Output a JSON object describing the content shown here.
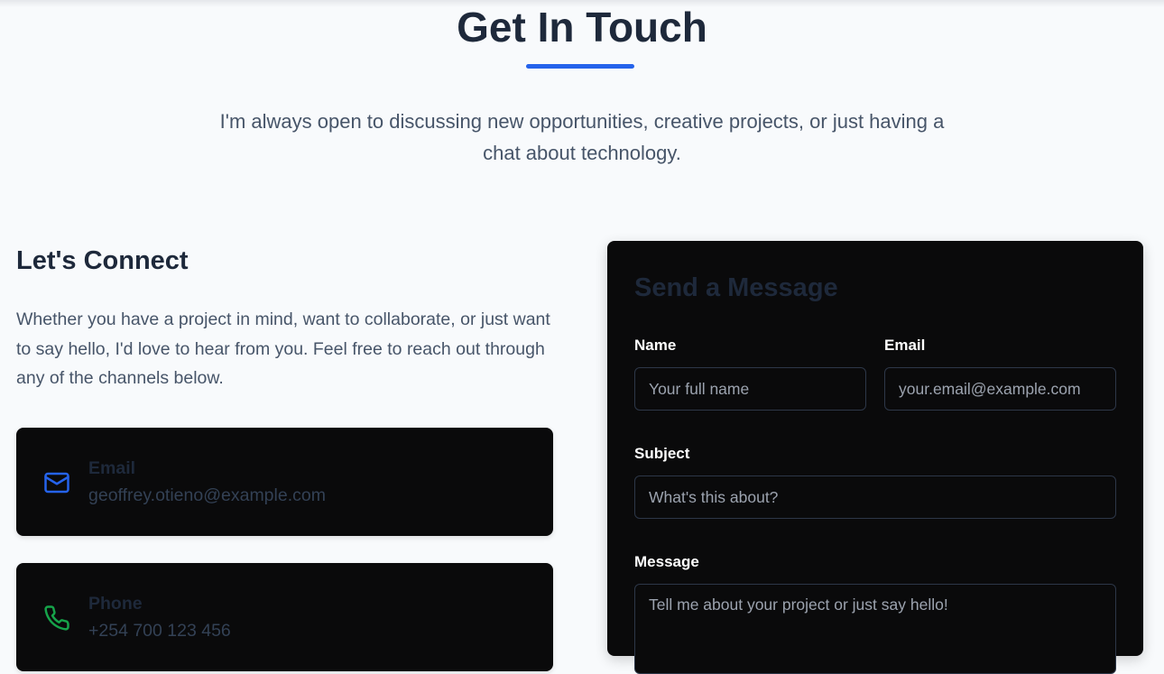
{
  "header": {
    "title": "Get In Touch",
    "intro": "I'm always open to discussing new opportunities, creative projects, or just having a chat about technology."
  },
  "connect": {
    "title": "Let's Connect",
    "text": "Whether you have a project in mind, want to collaborate, or just want to say hello, I'd love to hear from you. Feel free to reach out through any of the channels below.",
    "cards": [
      {
        "label": "Email",
        "value": "geoffrey.otieno@example.com",
        "icon": "mail-icon",
        "color": "#2563eb"
      },
      {
        "label": "Phone",
        "value": "+254 700 123 456",
        "icon": "phone-icon",
        "color": "#16a34a"
      }
    ]
  },
  "form": {
    "title": "Send a Message",
    "name_label": "Name",
    "name_placeholder": "Your full name",
    "email_label": "Email",
    "email_placeholder": "your.email@example.com",
    "subject_label": "Subject",
    "subject_placeholder": "What's this about?",
    "message_label": "Message",
    "message_placeholder": "Tell me about your project or just say hello!"
  },
  "colors": {
    "accent": "#2563eb",
    "card_bg": "#0a0a0b",
    "page_bg": "#f8fafc"
  }
}
